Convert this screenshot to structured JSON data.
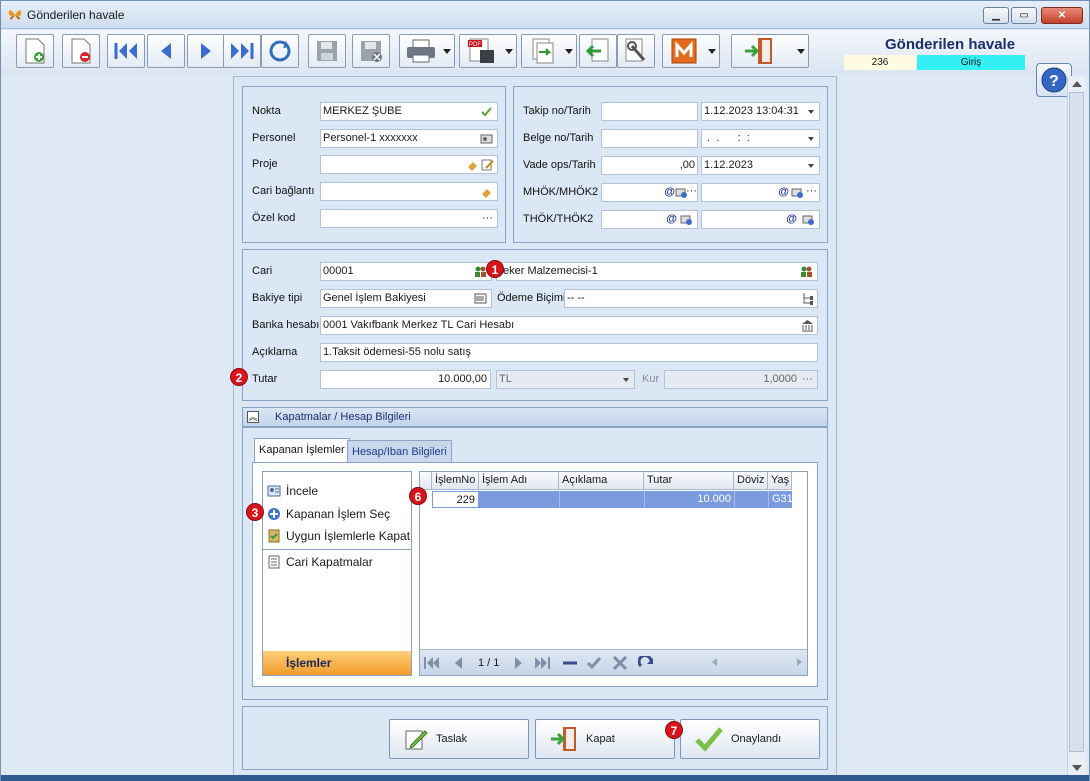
{
  "window": {
    "title": "Gönderilen havale"
  },
  "header": {
    "title": "Gönderilen havale",
    "record_no": "236",
    "mode": "Giriş"
  },
  "top_left": {
    "nokta_label": "Nokta",
    "nokta_value": "MERKEZ ŞUBE",
    "personel_label": "Personel",
    "personel_value": "Personel-1 xxxxxxx",
    "proje_label": "Proje",
    "proje_value": "",
    "cari_baglanti_label": "Cari bağlantı",
    "cari_baglanti_value": "",
    "ozel_kod_label": "Özel kod",
    "ozel_kod_value": ""
  },
  "top_right": {
    "takip_label": "Takip no/Tarih",
    "takip_no": "",
    "takip_tarih": "1.12.2023 13:04:31",
    "belge_label": "Belge no/Tarih",
    "belge_no": "",
    "belge_tarih": " .  .      :  :",
    "vade_label": "Vade ops/Tarih",
    "vade_ops": ",00",
    "vade_tarih": "1.12.2023",
    "mhok_label": "MHÖK/MHÖK2",
    "thok_label": "THÖK/THÖK2"
  },
  "cari": {
    "cari_label": "Cari",
    "cari_code": "00001",
    "cari_name": "eker Malzemecisi-1",
    "bakiye_label": "Bakiye tipi",
    "bakiye_value": "Genel İşlem Bakiyesi",
    "odeme_label": "Ödeme Biçimi",
    "odeme_value": "-- --",
    "banka_label": "Banka hesabı",
    "banka_value": "0001 Vakıfbank Merkez TL Cari Hesabı",
    "aciklama_label": "Açıklama",
    "aciklama_value": "1.Taksit ödemesi-55 nolu satış",
    "tutar_label": "Tutar",
    "tutar_value": "10.000,00",
    "currency": "TL",
    "kur_label": "Kur",
    "kur_value": "1,0000"
  },
  "group": {
    "title": "Kapatmalar / Hesap Bilgileri"
  },
  "tabs": [
    {
      "label": "Kapanan İşlemler"
    },
    {
      "label": "Hesap/Iban Bilgileri"
    }
  ],
  "actions": {
    "items": [
      "İncele",
      "Kapanan İşlem Seç",
      "Uygun İşlemlerle Kapat",
      "Cari Kapatmalar"
    ],
    "footer": "İşlemler"
  },
  "grid": {
    "columns": [
      "İşlemNo",
      "İşlem Adı",
      "Açıklama",
      "Tutar",
      "Döviz",
      "Yaş"
    ],
    "rows": [
      {
        "islem_no": "229",
        "islem_adi": "",
        "aciklama": "",
        "tutar": "10.000",
        "doviz": "",
        "yas": "G31"
      }
    ],
    "page": "1 / 1"
  },
  "buttons": {
    "taslak": "Taslak",
    "kapat": "Kapat",
    "onaylandi": "Onaylandı"
  },
  "badges": {
    "b1": "1",
    "b2": "2",
    "b3": "3",
    "b6": "6",
    "b7": "7"
  },
  "colors": {
    "accent": "#1c2f6b",
    "mode_bg": "#33f1f3",
    "badge": "#d9141b",
    "selection": "#7b9be0",
    "orange": "#f29b2b"
  }
}
